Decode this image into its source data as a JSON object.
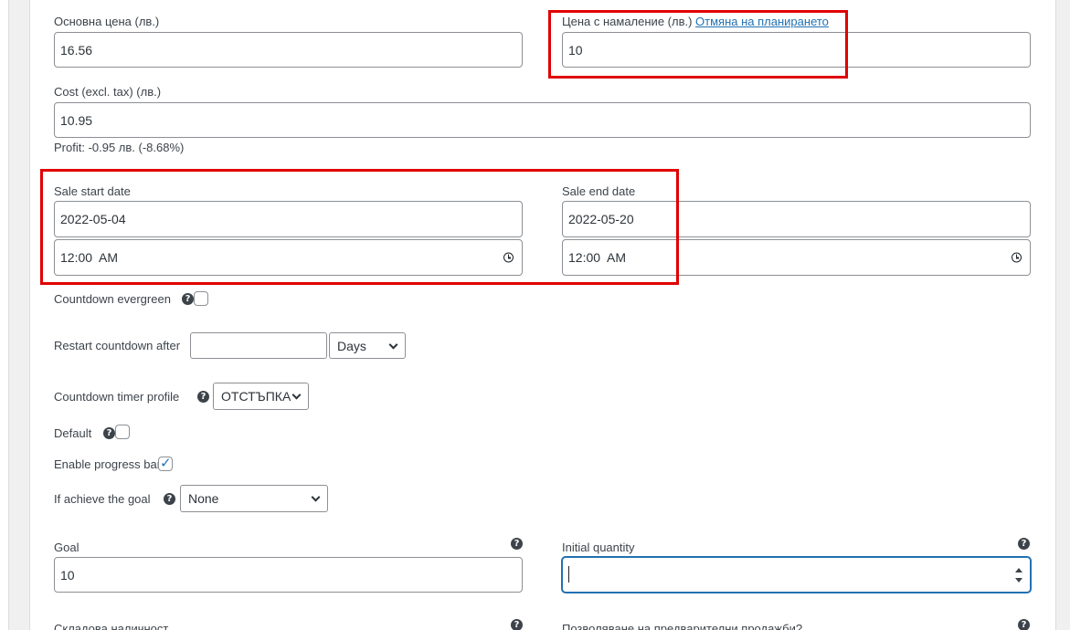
{
  "pricing": {
    "regular_price_label": "Основна цена (лв.)",
    "regular_price_value": "16.56",
    "sale_price_label": "Цена с намаление (лв.)",
    "cancel_schedule_link": "Отмяна на планирането",
    "sale_price_value": "10",
    "cost_label": "Cost (excl. tax) (лв.)",
    "cost_value": "10.95",
    "profit_text": "Profit: -0.95 лв. (-8.68%)"
  },
  "schedule": {
    "start_label": "Sale start date",
    "start_date": "2022-05-04",
    "start_time": "12:00  AM",
    "end_label": "Sale end date",
    "end_date": "2022-05-20",
    "end_time": "12:00  AM"
  },
  "countdown": {
    "evergreen_label": "Countdown evergreen",
    "evergreen_checked": false,
    "restart_label": "Restart countdown after",
    "restart_value": "",
    "restart_unit": "Days",
    "timer_profile_label": "Countdown timer profile",
    "timer_profile_value": "ОТСТЪПКА",
    "default_label": "Default",
    "default_checked": false,
    "progress_bar_label": "Enable progress bar",
    "progress_bar_checked": true,
    "achieve_goal_label": "If achieve the goal",
    "achieve_goal_value": "None"
  },
  "goal": {
    "goal_label": "Goal",
    "goal_value": "10",
    "initial_qty_label": "Initial quantity",
    "initial_qty_value": ""
  },
  "footer": {
    "stock_label": "Складова наличност",
    "backorders_label": "Позволяване на предварителни продажби?"
  },
  "icons": {
    "help": "?",
    "checkmark": "✓"
  },
  "colors": {
    "highlight": "#e00000",
    "link": "#2271b1",
    "focus": "#2271b1"
  }
}
